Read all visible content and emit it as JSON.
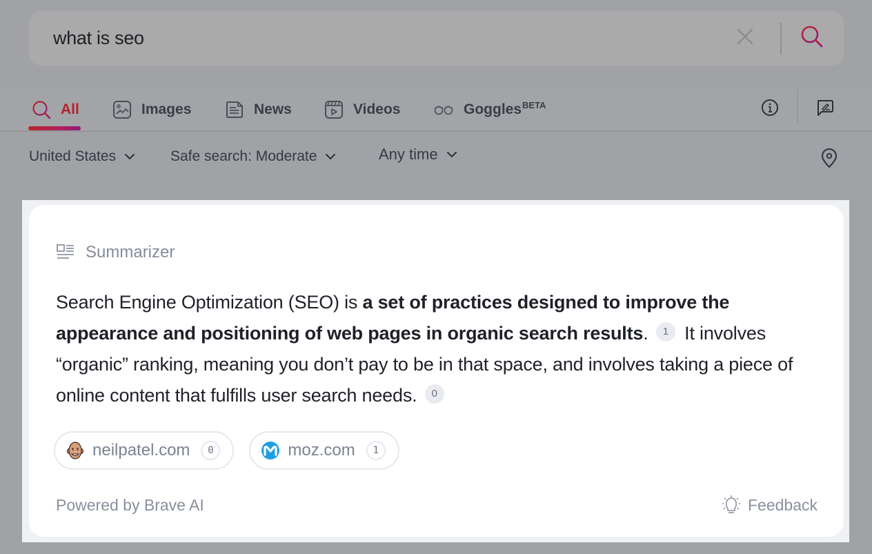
{
  "search": {
    "query": "what is seo",
    "clear_icon": "close-icon",
    "submit_icon": "search-icon"
  },
  "tabs": [
    {
      "label": "All",
      "icon": "search-icon",
      "active": true
    },
    {
      "label": "Images",
      "icon": "image-icon",
      "active": false
    },
    {
      "label": "News",
      "icon": "newspaper-icon",
      "active": false
    },
    {
      "label": "Videos",
      "icon": "video-icon",
      "active": false
    },
    {
      "label": "Goggles",
      "badge": "BETA",
      "icon": "goggles-icon",
      "active": false
    }
  ],
  "toolbar": {
    "info_icon": "info-icon",
    "feedback_icon": "feedback-icon"
  },
  "filters": {
    "country": "United States",
    "safe_search": "Safe search: Moderate",
    "time": "Any time",
    "location_icon": "location-pin-icon"
  },
  "summarizer": {
    "title": "Summarizer",
    "text": {
      "intro": "Search Engine Optimization (SEO) is ",
      "bold": "a set of practices designed to improve the appearance and positioning of web pages in organic search results",
      "period1": ".",
      "cite1": "1",
      "continued": "It involves “organic” ranking, meaning you don’t pay to be in that space, and involves taking a piece of online content that fulfills user search needs.",
      "cite2": "0"
    },
    "sources": [
      {
        "label": "neilpatel.com",
        "count": "0",
        "favicon": "neilpatel-avatar"
      },
      {
        "label": "moz.com",
        "count": "1",
        "favicon": "moz-logo"
      }
    ],
    "powered_by": "Powered by Brave AI",
    "feedback_label": "Feedback"
  },
  "colors": {
    "accent": "#b4232a",
    "accent_gradient_end": "#8f1a7a",
    "overlay_background": "#a1a2a6",
    "card_background": "#ffffff",
    "muted_text": "#868b9b"
  }
}
